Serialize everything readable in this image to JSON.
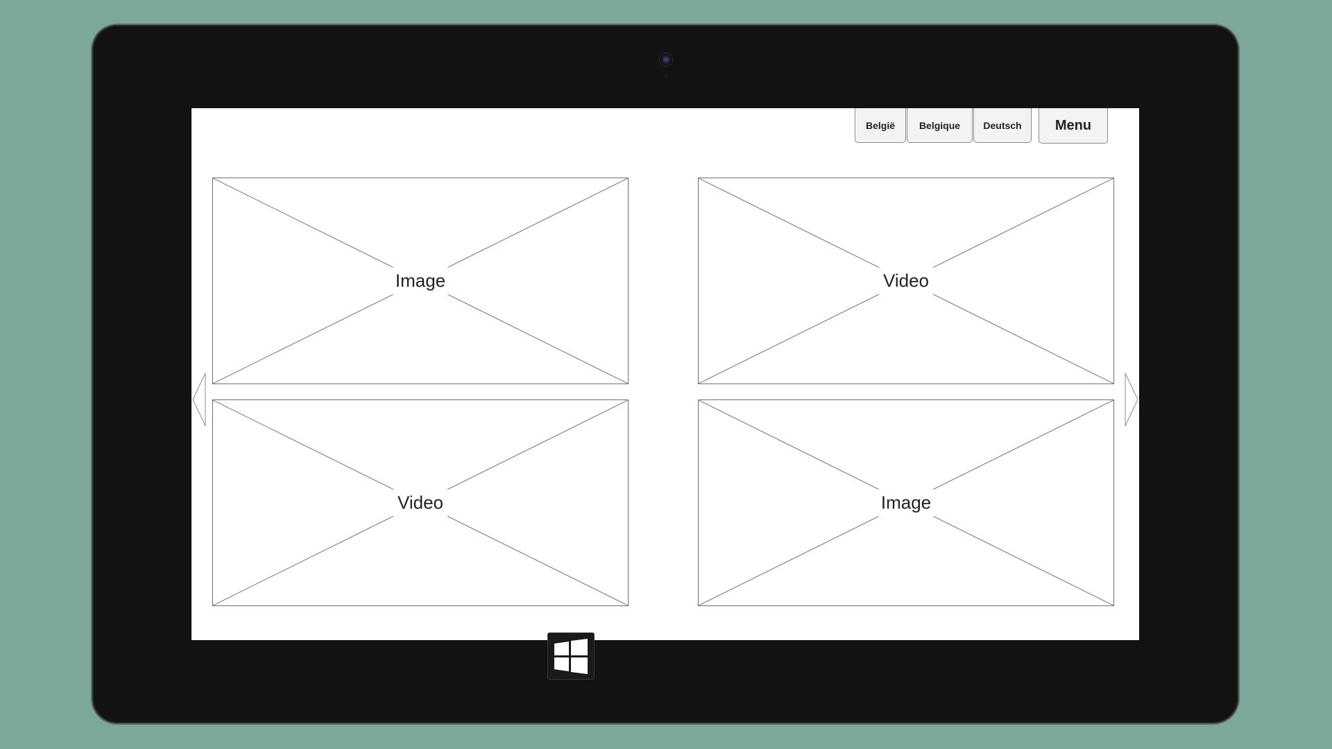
{
  "device": {
    "type": "tablet",
    "bezel_color": "#121211",
    "background_color": "#7ba89b"
  },
  "header": {
    "language_buttons": [
      {
        "label": "België"
      },
      {
        "label": "Belgique"
      },
      {
        "label": "Deutsch"
      }
    ],
    "menu_label": "Menu"
  },
  "grid": {
    "tiles": [
      {
        "label": "Image"
      },
      {
        "label": "Video"
      },
      {
        "label": "Video"
      },
      {
        "label": "Image"
      }
    ]
  },
  "navigation": {
    "prev_icon": "triangle-left-icon",
    "next_icon": "triangle-right-icon"
  },
  "hardware": {
    "home_icon": "windows-logo-icon"
  }
}
